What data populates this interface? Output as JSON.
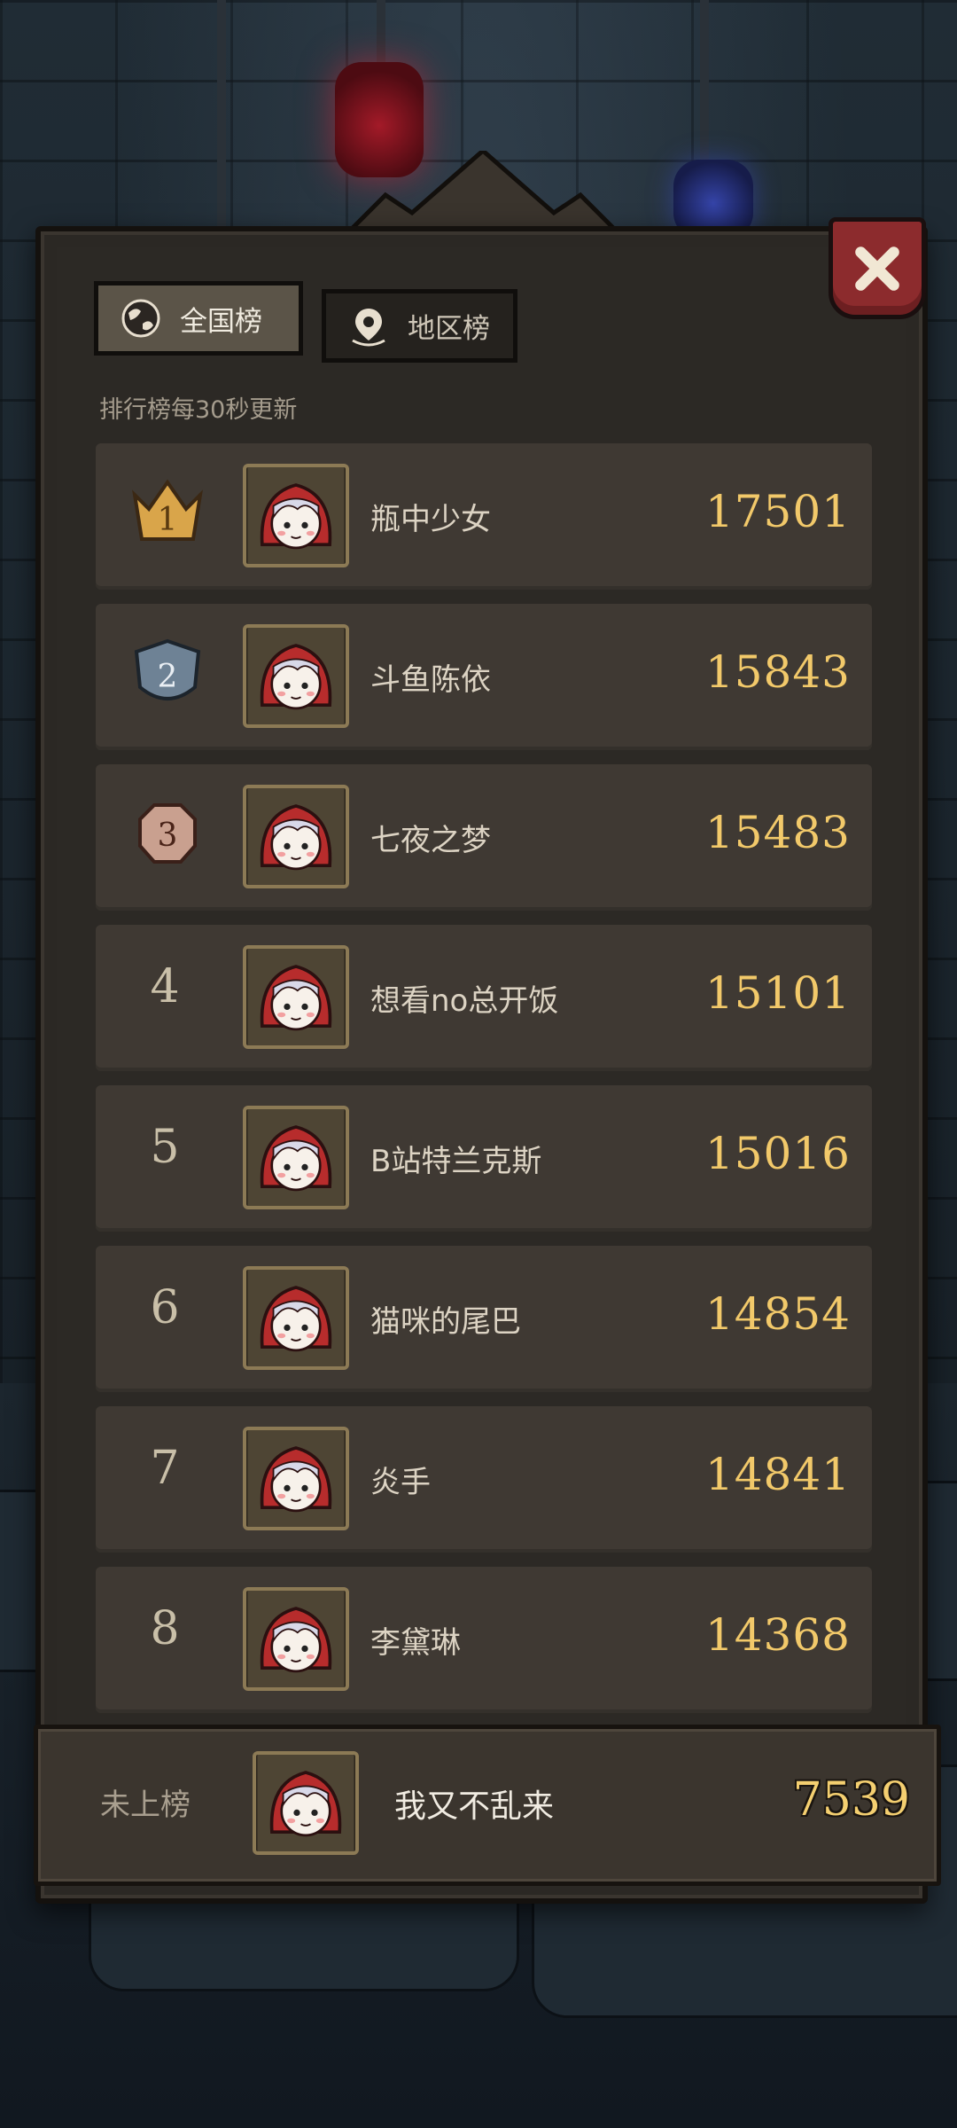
{
  "tabs": [
    {
      "label": "全国榜",
      "icon": "globe-icon",
      "active": true
    },
    {
      "label": "地区榜",
      "icon": "location-pin-icon",
      "active": false
    }
  ],
  "update_note": "排行榜每30秒更新",
  "leaderboard": [
    {
      "rank": "1",
      "name": "瓶中少女",
      "score": "17501",
      "badge": "gold-crown-badge"
    },
    {
      "rank": "2",
      "name": "斗鱼陈依",
      "score": "15843",
      "badge": "silver-shield-badge"
    },
    {
      "rank": "3",
      "name": "七夜之梦",
      "score": "15483",
      "badge": "bronze-shield-badge"
    },
    {
      "rank": "4",
      "name": "想看no总开饭",
      "score": "15101"
    },
    {
      "rank": "5",
      "name": "B站特兰克斯",
      "score": "15016"
    },
    {
      "rank": "6",
      "name": "猫咪的尾巴",
      "score": "14854"
    },
    {
      "rank": "7",
      "name": "炎手",
      "score": "14841"
    },
    {
      "rank": "8",
      "name": "李黛琳",
      "score": "14368"
    }
  ],
  "self": {
    "status": "未上榜",
    "name": "我又不乱来",
    "score": "7539"
  },
  "colors": {
    "score_gold": "#f2c96a",
    "panel_bg": "#2b2824",
    "row_bg": "#3f3933",
    "close_red": "#8c2b2d"
  }
}
